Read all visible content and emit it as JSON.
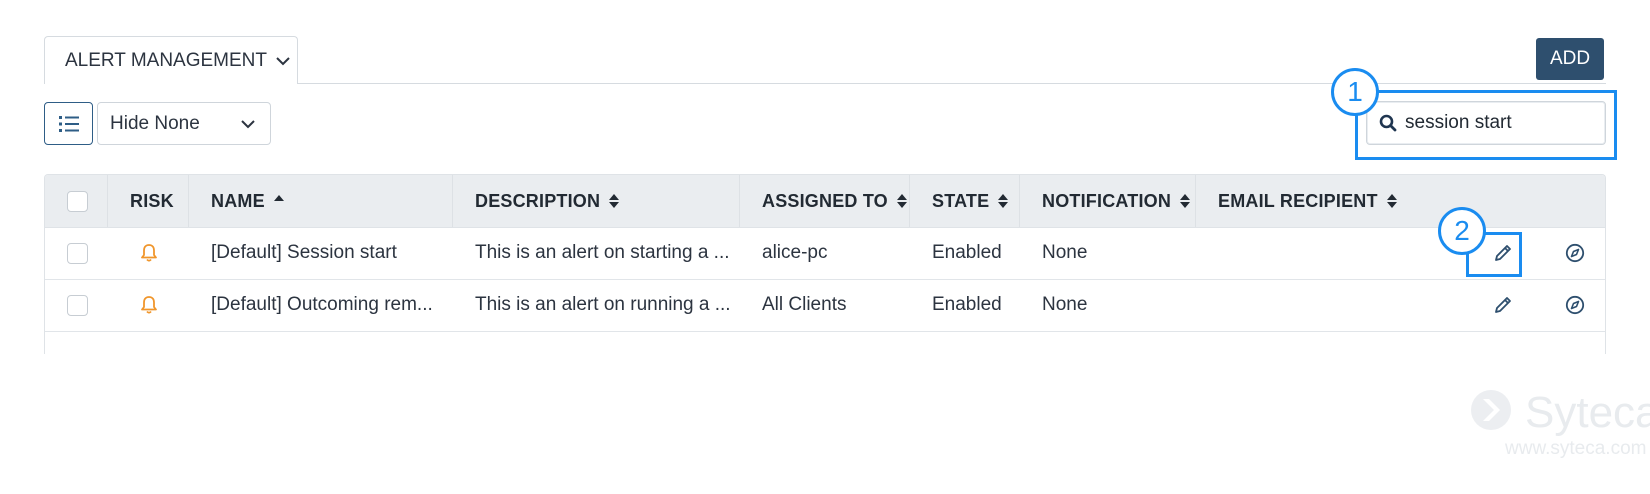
{
  "tab": {
    "label": "ALERT MANAGEMENT"
  },
  "toolbar": {
    "add_label": "ADD",
    "filter_value": "Hide None"
  },
  "search": {
    "value": "session start"
  },
  "callouts": [
    "1",
    "2"
  ],
  "table": {
    "columns": [
      "RISK",
      "NAME",
      "DESCRIPTION",
      "ASSIGNED TO",
      "STATE",
      "NOTIFICATION",
      "EMAIL RECIPIENT"
    ],
    "rows": [
      {
        "name": "[Default] Session start",
        "description": "This is an alert on starting a ...",
        "assigned_to": "alice-pc",
        "state": "Enabled",
        "notification": "None",
        "email_recipient": ""
      },
      {
        "name": "[Default] Outcoming rem...",
        "description": "This is an alert on running a ...",
        "assigned_to": "All Clients",
        "state": "Enabled",
        "notification": "None",
        "email_recipient": ""
      }
    ]
  },
  "watermark": {
    "brand": "Syteca",
    "url": "www.syteca.com"
  },
  "colors": {
    "accent": "#1a8cf0",
    "button": "#2e4f6e",
    "bell": "#f0962c"
  }
}
